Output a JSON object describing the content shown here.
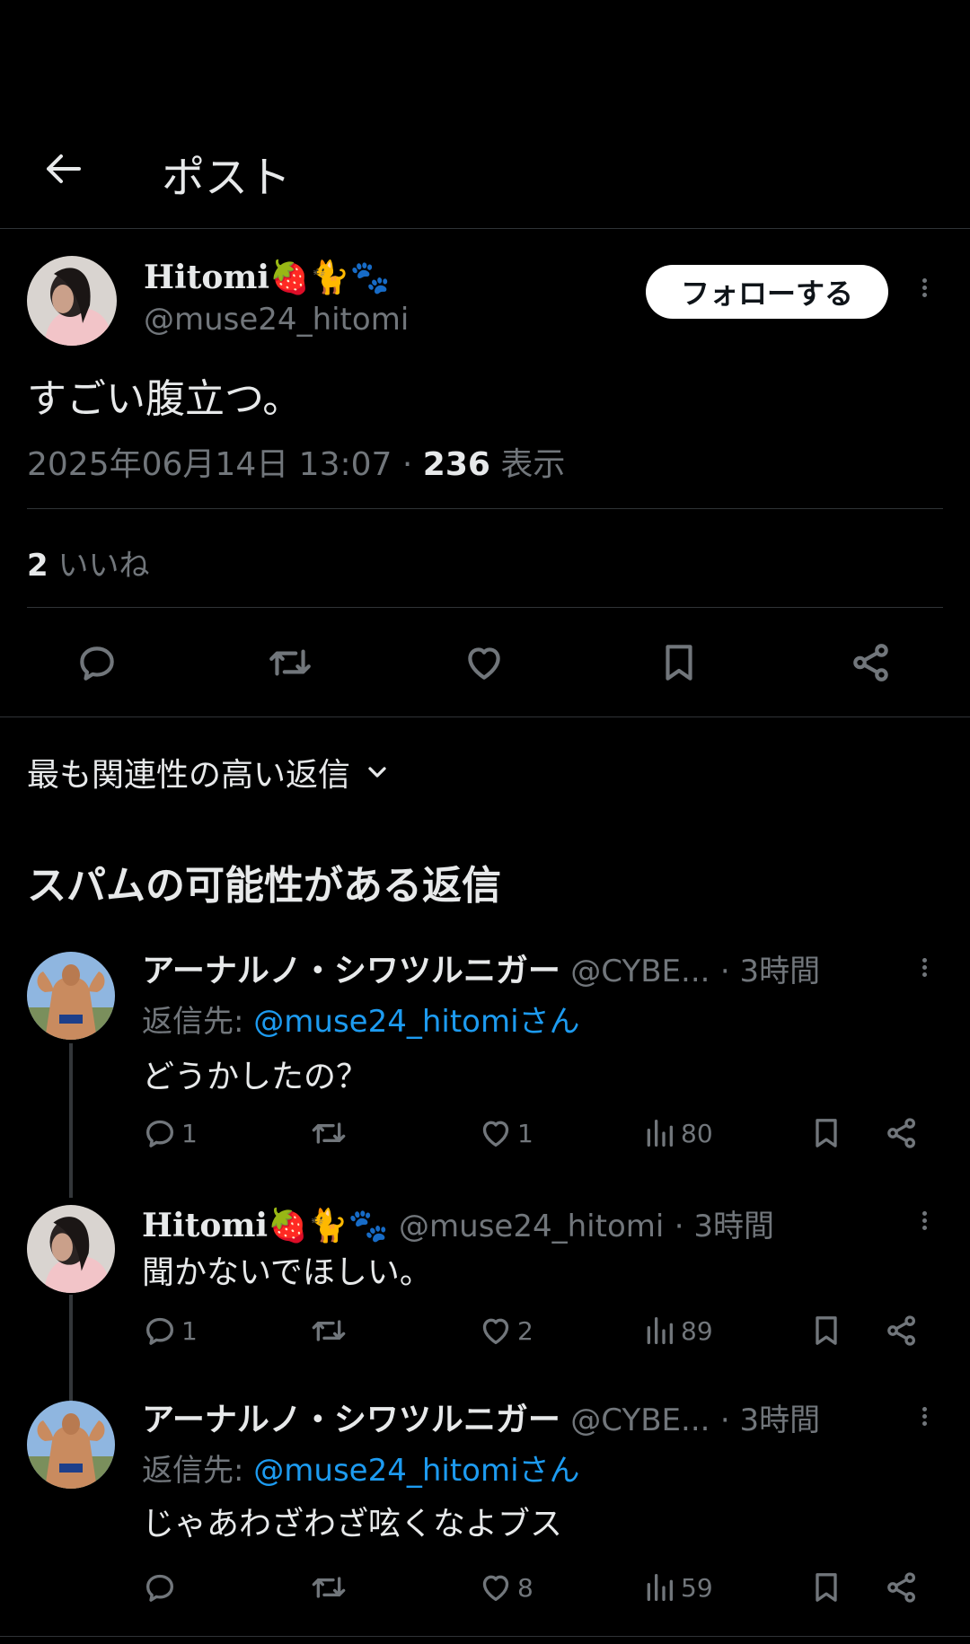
{
  "header": {
    "title": "ポスト",
    "back_icon": "arrow-left-icon"
  },
  "post": {
    "author_name": "Hitomi",
    "author_emojis": "🍓🐈🐾",
    "author_handle": "@muse24_hitomi",
    "follow_label": "フォローする",
    "text": "すごい腹立つ。",
    "timestamp": "2025年06月14日 13:07",
    "dot": "·",
    "views_count": "236",
    "views_label": "表示",
    "likes_count": "2",
    "likes_label": "いいね"
  },
  "sort": {
    "label": "最も関連性の高い返信"
  },
  "spam_section": {
    "title": "スパムの可能性がある返信"
  },
  "replies": [
    {
      "name": "アーナルノ・シワツルニガー",
      "handle": "@CYBE...",
      "time": "· 3時間",
      "reply_prefix": "返信先:",
      "reply_to": "@muse24_hitomiさん",
      "text": "どうかしたの？",
      "replies": "1",
      "reposts": "",
      "likes": "1",
      "views": "80"
    },
    {
      "name": "Hitomi",
      "name_emojis": "🍓🐈🐾",
      "handle": "@muse24_hitomi",
      "time": "· 3時間",
      "text": "聞かないでほしい。",
      "replies": "1",
      "reposts": "",
      "likes": "2",
      "views": "89"
    },
    {
      "name": "アーナルノ・シワツルニガー",
      "handle": "@CYBE...",
      "time": "· 3時間",
      "reply_prefix": "返信先:",
      "reply_to": "@muse24_hitomiさん",
      "text": "じゃあわざわざ呟くなよブス",
      "replies": "",
      "reposts": "",
      "likes": "8",
      "views": "59"
    }
  ],
  "colors": {
    "background": "#000000",
    "text": "#e7e9ea",
    "muted": "#71767b",
    "link": "#1d9bf0",
    "separator": "#2f3336"
  }
}
